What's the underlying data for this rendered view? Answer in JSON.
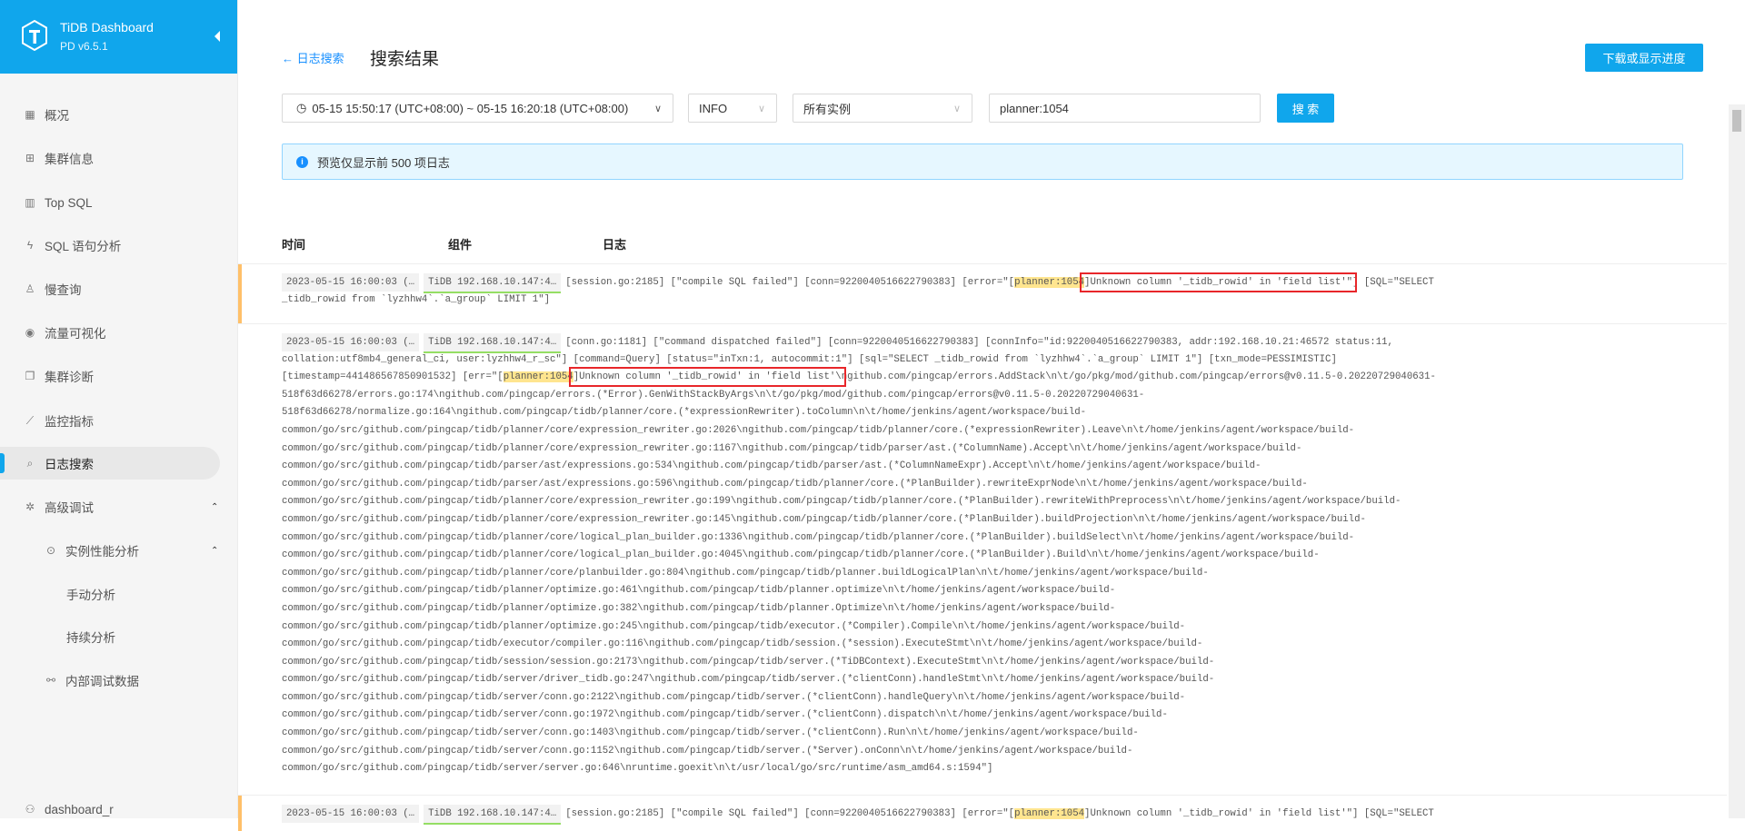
{
  "brand": {
    "title": "TiDB Dashboard",
    "version": "PD v6.5.1"
  },
  "sidebar": {
    "items": [
      {
        "label": "概况",
        "icon": "grid-icon"
      },
      {
        "label": "集群信息",
        "icon": "cluster-icon"
      },
      {
        "label": "Top SQL",
        "icon": "bar-chart-icon"
      },
      {
        "label": "SQL 语句分析",
        "icon": "lightning-icon"
      },
      {
        "label": "慢查询",
        "icon": "rocket-icon"
      },
      {
        "label": "流量可视化",
        "icon": "eye-icon"
      },
      {
        "label": "集群诊断",
        "icon": "file-copy-icon"
      },
      {
        "label": "监控指标",
        "icon": "line-chart-icon"
      },
      {
        "label": "日志搜索",
        "icon": "file-search-icon",
        "active": true
      },
      {
        "label": "高级调试",
        "icon": "bug-icon"
      },
      {
        "label": "实例性能分析",
        "icon": "aim-icon"
      },
      {
        "label": "手动分析"
      },
      {
        "label": "持续分析"
      },
      {
        "label": "内部调试数据",
        "icon": "api-icon"
      }
    ],
    "user": "dashboard_r"
  },
  "header": {
    "back_label": "日志搜索",
    "title": "搜索结果",
    "download_label": "下载或显示进度"
  },
  "filters": {
    "time_range": "05-15 15:50:17 (UTC+08:00) ~ 05-15 16:20:18 (UTC+08:00)",
    "level": "INFO",
    "instances": "所有实例",
    "keyword": "planner:1054",
    "search_label": "搜 索"
  },
  "alert": "预览仅显示前 500 项日志",
  "columns": [
    "时间",
    "组件",
    "日志"
  ],
  "logs": [
    {
      "time": "2023-05-15 16:00:03 (…",
      "component": "TiDB 192.168.10.147:4…",
      "warn": true,
      "lines": [
        {
          "pre": "[session.go:2185] [\"compile SQL failed\"] [conn=9220040516622790383] [error=\"[",
          "hl": "planner:1054",
          "box": "]Unknown column '_tidb_rowid' in 'field list'\"",
          "post": "] [SQL=\"SELECT"
        },
        "_tidb_rowid from `lyzhhw4`.`a_group` LIMIT 1\"]"
      ]
    },
    {
      "time": "2023-05-15 16:00:03 (…",
      "component": "TiDB 192.168.10.147:4…",
      "warn": false,
      "lines": [
        "[conn.go:1181] [\"command dispatched failed\"] [conn=9220040516622790383] [connInfo=\"id:9220040516622790383, addr:192.168.10.21:46572 status:11,",
        "collation:utf8mb4_general_ci, user:lyzhhw4_r_sc\"] [command=Query] [status=\"inTxn:1, autocommit:1\"] [sql=\"SELECT _tidb_rowid from `lyzhhw4`.`a_group` LIMIT 1\"] [txn_mode=PESSIMISTIC]",
        {
          "pre": "[timestamp=441486567850901532] [err=\"[",
          "hl": "planner:1054",
          "box": "]Unknown column '_tidb_rowid' in 'field list'\\",
          "post": "ngithub.com/pingcap/errors.AddStack\\n\\t/go/pkg/mod/github.com/pingcap/errors@v0.11.5-0.20220729040631-"
        },
        "518f63d66278/errors.go:174\\ngithub.com/pingcap/errors.(*Error).GenWithStackByArgs\\n\\t/go/pkg/mod/github.com/pingcap/errors@v0.11.5-0.20220729040631-",
        "518f63d66278/normalize.go:164\\ngithub.com/pingcap/tidb/planner/core.(*expressionRewriter).toColumn\\n\\t/home/jenkins/agent/workspace/build-",
        "common/go/src/github.com/pingcap/tidb/planner/core/expression_rewriter.go:2026\\ngithub.com/pingcap/tidb/planner/core.(*expressionRewriter).Leave\\n\\t/home/jenkins/agent/workspace/build-",
        "common/go/src/github.com/pingcap/tidb/planner/core/expression_rewriter.go:1167\\ngithub.com/pingcap/tidb/parser/ast.(*ColumnName).Accept\\n\\t/home/jenkins/agent/workspace/build-",
        "common/go/src/github.com/pingcap/tidb/parser/ast/expressions.go:534\\ngithub.com/pingcap/tidb/parser/ast.(*ColumnNameExpr).Accept\\n\\t/home/jenkins/agent/workspace/build-",
        "common/go/src/github.com/pingcap/tidb/parser/ast/expressions.go:596\\ngithub.com/pingcap/tidb/planner/core.(*PlanBuilder).rewriteExprNode\\n\\t/home/jenkins/agent/workspace/build-",
        "common/go/src/github.com/pingcap/tidb/planner/core/expression_rewriter.go:199\\ngithub.com/pingcap/tidb/planner/core.(*PlanBuilder).rewriteWithPreprocess\\n\\t/home/jenkins/agent/workspace/build-",
        "common/go/src/github.com/pingcap/tidb/planner/core/expression_rewriter.go:145\\ngithub.com/pingcap/tidb/planner/core.(*PlanBuilder).buildProjection\\n\\t/home/jenkins/agent/workspace/build-",
        "common/go/src/github.com/pingcap/tidb/planner/core/logical_plan_builder.go:1336\\ngithub.com/pingcap/tidb/planner/core.(*PlanBuilder).buildSelect\\n\\t/home/jenkins/agent/workspace/build-",
        "common/go/src/github.com/pingcap/tidb/planner/core/logical_plan_builder.go:4045\\ngithub.com/pingcap/tidb/planner/core.(*PlanBuilder).Build\\n\\t/home/jenkins/agent/workspace/build-",
        "common/go/src/github.com/pingcap/tidb/planner/core/planbuilder.go:804\\ngithub.com/pingcap/tidb/planner.buildLogicalPlan\\n\\t/home/jenkins/agent/workspace/build-",
        "common/go/src/github.com/pingcap/tidb/planner/optimize.go:461\\ngithub.com/pingcap/tidb/planner.optimize\\n\\t/home/jenkins/agent/workspace/build-",
        "common/go/src/github.com/pingcap/tidb/planner/optimize.go:382\\ngithub.com/pingcap/tidb/planner.Optimize\\n\\t/home/jenkins/agent/workspace/build-",
        "common/go/src/github.com/pingcap/tidb/planner/optimize.go:245\\ngithub.com/pingcap/tidb/executor.(*Compiler).Compile\\n\\t/home/jenkins/agent/workspace/build-",
        "common/go/src/github.com/pingcap/tidb/executor/compiler.go:116\\ngithub.com/pingcap/tidb/session.(*session).ExecuteStmt\\n\\t/home/jenkins/agent/workspace/build-",
        "common/go/src/github.com/pingcap/tidb/session/session.go:2173\\ngithub.com/pingcap/tidb/server.(*TiDBContext).ExecuteStmt\\n\\t/home/jenkins/agent/workspace/build-",
        "common/go/src/github.com/pingcap/tidb/server/driver_tidb.go:247\\ngithub.com/pingcap/tidb/server.(*clientConn).handleStmt\\n\\t/home/jenkins/agent/workspace/build-",
        "common/go/src/github.com/pingcap/tidb/server/conn.go:2122\\ngithub.com/pingcap/tidb/server.(*clientConn).handleQuery\\n\\t/home/jenkins/agent/workspace/build-",
        "common/go/src/github.com/pingcap/tidb/server/conn.go:1972\\ngithub.com/pingcap/tidb/server.(*clientConn).dispatch\\n\\t/home/jenkins/agent/workspace/build-",
        "common/go/src/github.com/pingcap/tidb/server/conn.go:1403\\ngithub.com/pingcap/tidb/server.(*clientConn).Run\\n\\t/home/jenkins/agent/workspace/build-",
        "common/go/src/github.com/pingcap/tidb/server/conn.go:1152\\ngithub.com/pingcap/tidb/server.(*Server).onConn\\n\\t/home/jenkins/agent/workspace/build-",
        "common/go/src/github.com/pingcap/tidb/server/server.go:646\\nruntime.goexit\\n\\t/usr/local/go/src/runtime/asm_amd64.s:1594\"]"
      ]
    },
    {
      "time": "2023-05-15 16:00:03 (…",
      "component": "TiDB 192.168.10.147:4…",
      "warn": true,
      "lines": [
        {
          "pre": "[session.go:2185] [\"compile SQL failed\"] [conn=9220040516622790383] [error=\"[",
          "hl": "planner:1054",
          "box": "",
          "post": "]Unknown column '_tidb_rowid' in 'field list'\"] [SQL=\"SELECT"
        }
      ]
    }
  ]
}
